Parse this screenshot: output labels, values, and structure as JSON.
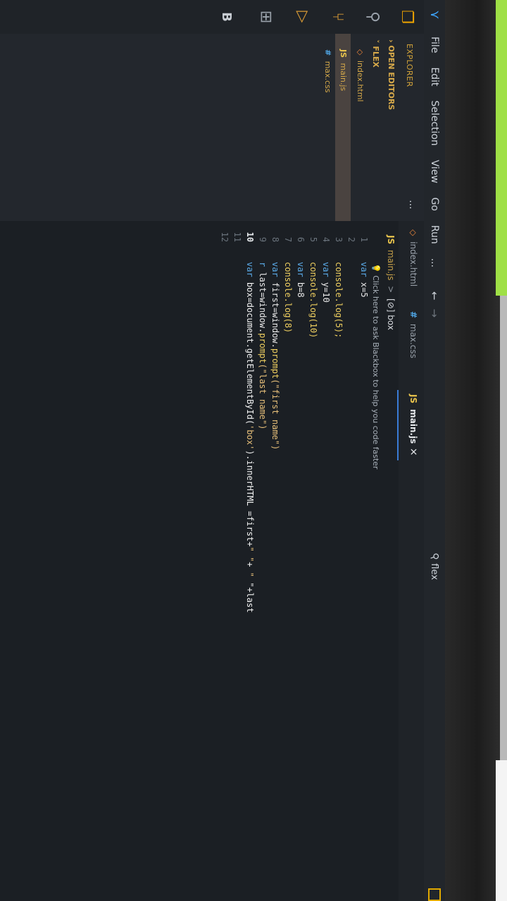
{
  "menu": {
    "items": [
      "File",
      "Edit",
      "Selection",
      "View",
      "Go",
      "Run",
      "..."
    ],
    "back_arrow": "←",
    "forward_arrow": "→"
  },
  "search": {
    "text": "flex",
    "icon": "search-icon"
  },
  "activity_bar": {
    "icons": [
      "explorer-icon",
      "search-icon",
      "source-control-icon",
      "run-debug-icon",
      "extensions-icon"
    ],
    "b_label": "B"
  },
  "sidebar": {
    "header": "EXPLORER",
    "more": "...",
    "open_editors": "OPEN EDITORS",
    "folder": "FLEX",
    "files": [
      {
        "icon": "◇",
        "name": "index.html"
      },
      {
        "icon": "JS",
        "name": "main.js"
      },
      {
        "icon": "#",
        "name": "max.css"
      }
    ]
  },
  "tabs": [
    {
      "icon": "◇",
      "label": "index.html"
    },
    {
      "icon": "#",
      "label": "max.css"
    },
    {
      "icon": "JS",
      "label": "main.js",
      "close": "×"
    }
  ],
  "breadcrumb": {
    "file_icon": "JS",
    "file": "main.js",
    "separator": ">",
    "symbol": "[⊘] box"
  },
  "code": {
    "hint": "Click here to ask Blackbox to help you code faster",
    "line_numbers": [
      "1",
      "2",
      "3",
      "4",
      "5",
      "6",
      "7",
      "8",
      "9",
      "10",
      "11",
      "12"
    ],
    "active_line": "10",
    "lines": {
      "l1": {
        "kw": "var",
        "rest": " x=5"
      },
      "l3": {
        "fn": "console.log",
        "args": "(5);"
      },
      "l4": {
        "kw": "var",
        "rest": " y=10"
      },
      "l5": {
        "fn": "console.log",
        "args": "(10)"
      },
      "l6": {
        "kw": "var",
        "rest": " b=8"
      },
      "l7": {
        "fn": "console.log",
        "args": "(8)"
      },
      "l8": {
        "kw": "var",
        "a": " first=window.",
        "fn": "prompt",
        "str": "(\"first name\")"
      },
      "l9": {
        "kw": "r",
        "a": " last=window.",
        "fn": "prompt",
        "str": "(\"last name\")"
      },
      "l10": {
        "kw": "var",
        "a": " box=document.getElementById(",
        "str1": "'box'",
        "b": ").innerHTML =first+",
        "str2": "\" \"",
        "c": "+ ",
        "str3": "\"",
        "d": " \"+last"
      }
    }
  },
  "colors": {
    "accent": "#3a7bd5",
    "explorer_label": "#d5a53a",
    "keyword": "#5aa9e6",
    "function": "#f0d060"
  }
}
